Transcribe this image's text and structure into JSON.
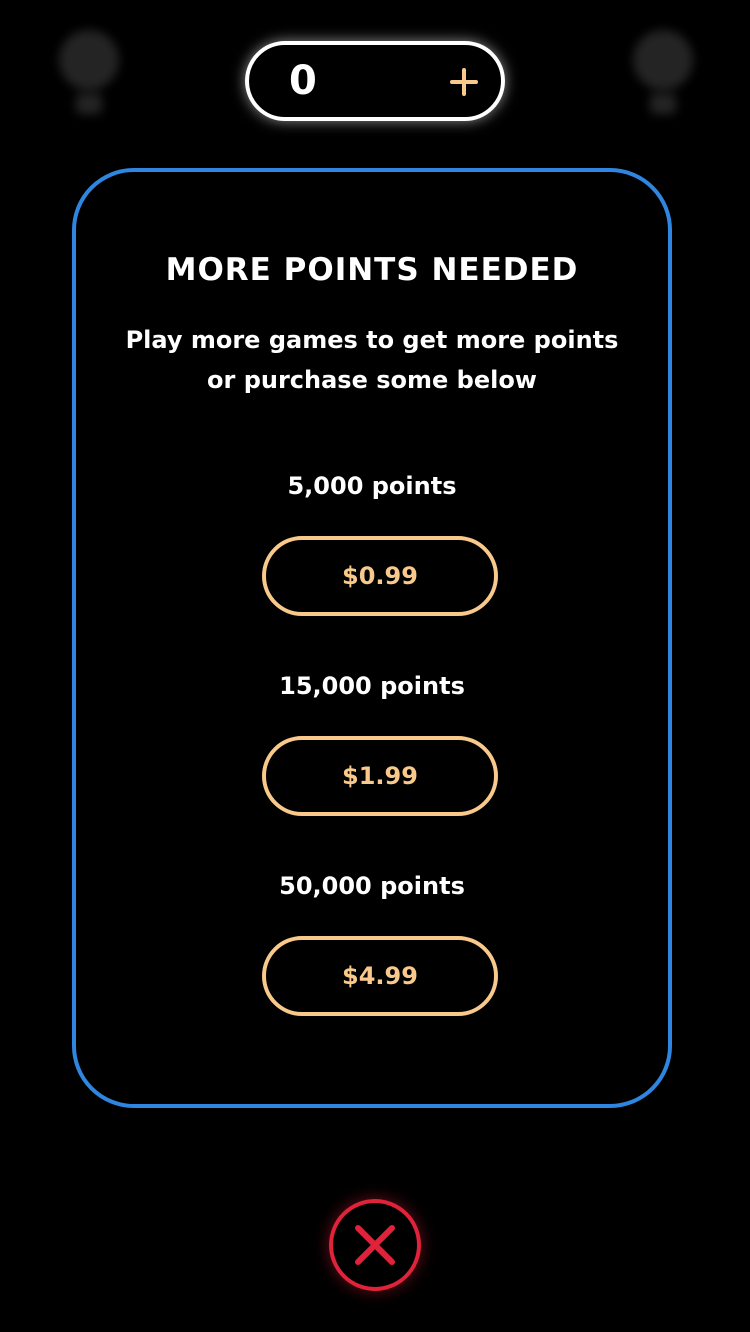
{
  "header": {
    "points_value": "0",
    "add_icon": "plus-icon"
  },
  "modal": {
    "title": "MORE POINTS NEEDED",
    "message": "Play more games to get more points or purchase some below",
    "offers": [
      {
        "points_label": "5,000 points",
        "price": "$0.99"
      },
      {
        "points_label": "15,000 points",
        "price": "$1.99"
      },
      {
        "points_label": "50,000 points",
        "price": "$4.99"
      }
    ]
  },
  "footer": {
    "close_icon": "close-icon"
  },
  "colors": {
    "background": "#000000",
    "modal_border": "#2f86e0",
    "accent": "#f8c98a",
    "close": "#e0223a"
  }
}
